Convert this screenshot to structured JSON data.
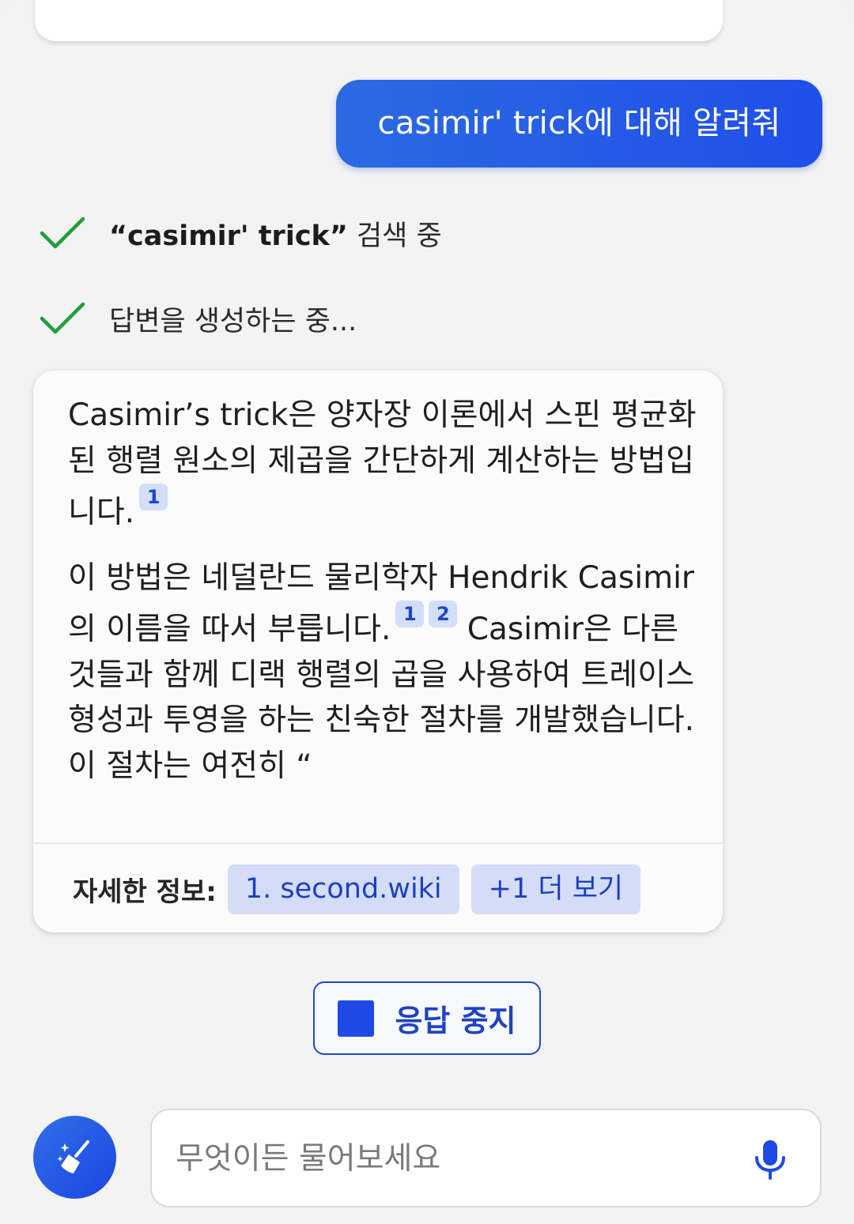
{
  "chat": {
    "user_message": "casimir' trick에 대해 알려줘",
    "status": {
      "search_term": "“casimir' trick”",
      "search_suffix": " 검색 중",
      "generating": "답변을 생성하는 중..."
    },
    "answer": {
      "p1": "Casimir’s trick은 양자장 이론에서 스핀 평균화된 행렬 원소의 제곱을 간단하게 계산하는 방법입니다.",
      "p1_cites": [
        "1"
      ],
      "p2_a": "이 방법은 네덜란드 물리학자 Hendrik Casimir의 이름을 따서 부릅니다.",
      "p2_cites": [
        "1",
        "2"
      ],
      "p2_b": "Casimir은 다른 것들과 함께 디랙 행렬의 곱을 사용하여 트레이스 형성과 투영을 하는 친숙한 절차를 개발했습니다. 이 절차는 여전히 “"
    },
    "sources": {
      "label": "자세한 정보:",
      "items": [
        "1. second.wiki"
      ],
      "more": "+1 더 보기"
    },
    "stop_button": "응답 중지"
  },
  "composer": {
    "placeholder": "무엇이든 물어보세요"
  },
  "colors": {
    "accent": "#1f4ae6",
    "check": "#1f9e3a",
    "chip_bg": "#d4ddf8"
  },
  "icons": {
    "check": "check-icon",
    "clear": "broom-sparkle-icon",
    "mic": "microphone-icon",
    "stop": "stop-square-icon"
  }
}
